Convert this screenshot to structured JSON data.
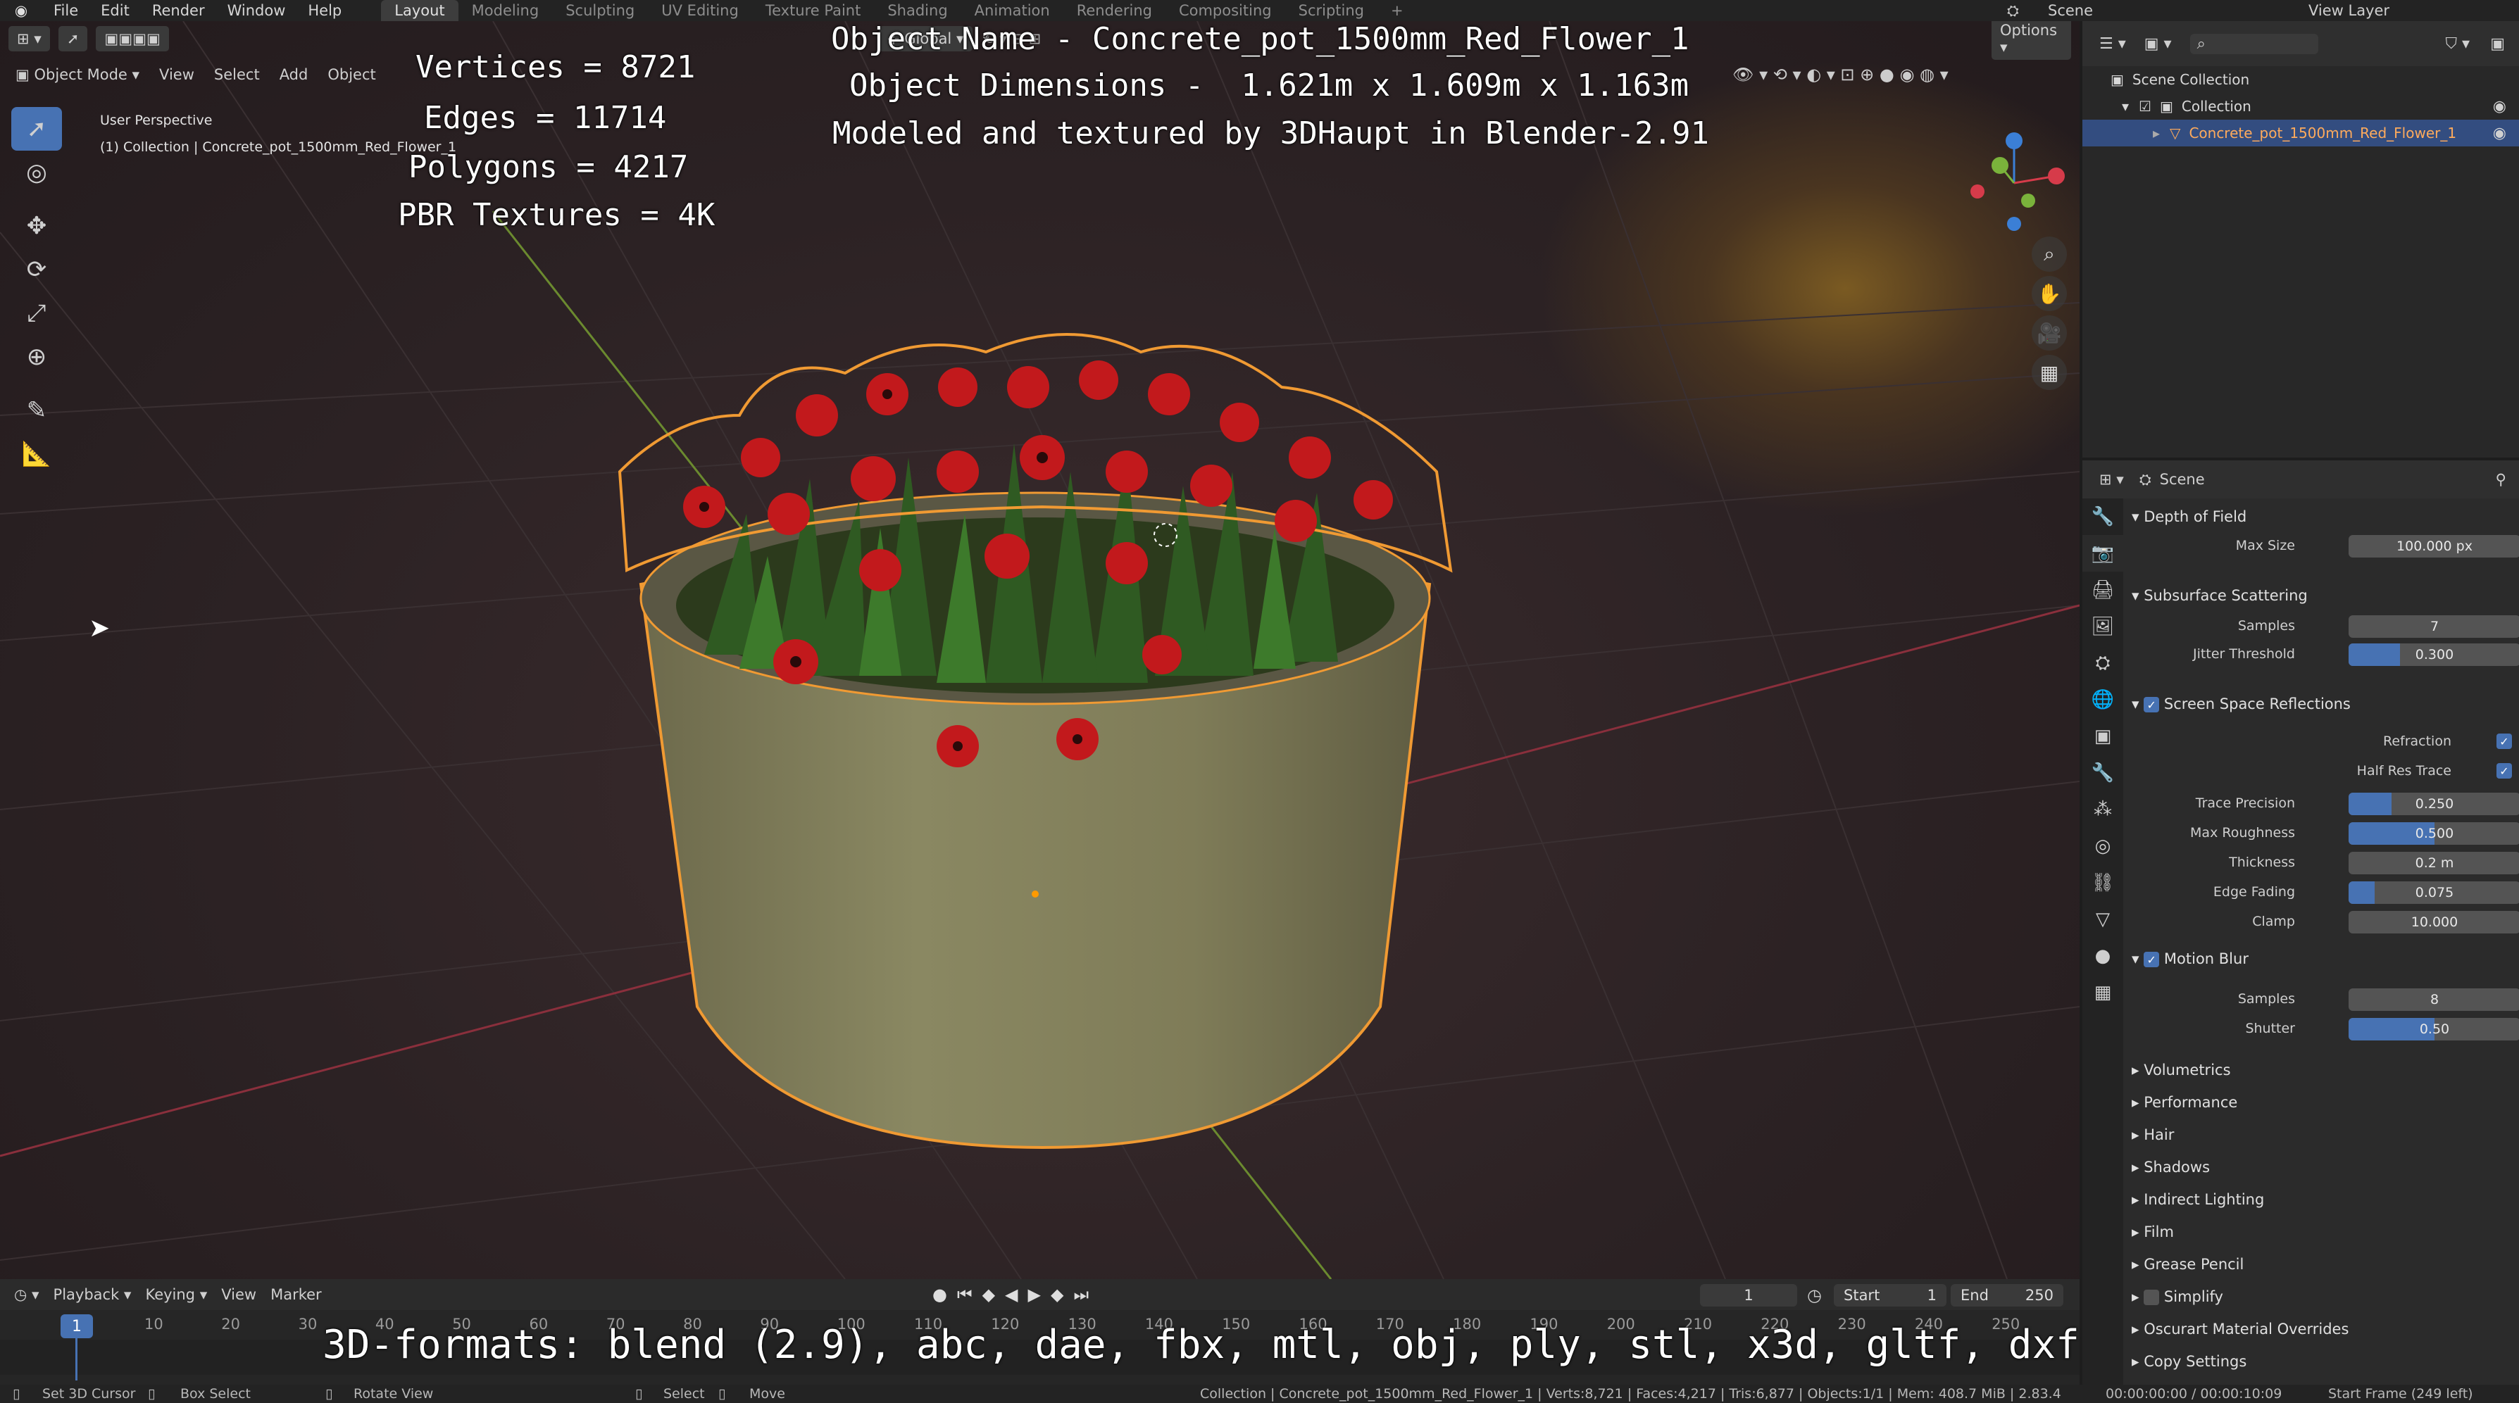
{
  "menu": [
    "File",
    "Edit",
    "Render",
    "Window",
    "Help"
  ],
  "workspaces": [
    "Layout",
    "Modeling",
    "Sculpting",
    "UV Editing",
    "Texture Paint",
    "Shading",
    "Animation",
    "Rendering",
    "Compositing",
    "Scripting"
  ],
  "active_workspace": "Layout",
  "top_right": {
    "scene": "Scene",
    "view_layer": "View Layer"
  },
  "viewport": {
    "mode": "Object Mode",
    "menus": [
      "View",
      "Select",
      "Add",
      "Object"
    ],
    "transform": "Global",
    "options": "Options",
    "perspective": "User Perspective",
    "collection": "(1) Collection | Concrete_pot_1500mm_Red_Flower_1"
  },
  "overlay": {
    "vertices": "Vertices = 8721",
    "edges": "Edges = 11714",
    "polygons": "Polygons = 4217",
    "textures": "PBR Textures = 4K",
    "object_name": "Object Name - Concrete_pot_1500mm_Red_Flower_1",
    "dimensions": "Object Dimensions -  1.621m x 1.609m x 1.163m",
    "credits": "Modeled and textured by 3DHaupt in Blender-2.91",
    "formats": "3D-formats: blend (2.9), abc, dae, fbx, mtl, obj, ply, stl, x3d, gltf, dxf"
  },
  "timeline": {
    "menus": [
      "Playback",
      "Keying",
      "View",
      "Marker"
    ],
    "current_frame": "1",
    "start_label": "Start",
    "start": "1",
    "end_label": "End",
    "end": "250",
    "ticks": [
      "10",
      "20",
      "30",
      "40",
      "50",
      "60",
      "70",
      "80",
      "90",
      "100",
      "110",
      "120",
      "130",
      "140",
      "150",
      "160",
      "170",
      "180",
      "190",
      "200",
      "210",
      "220",
      "230",
      "240",
      "250"
    ],
    "marker": "1"
  },
  "statusbar": {
    "set_cursor": "Set 3D Cursor",
    "box_select": "Box Select",
    "rotate": "Rotate View",
    "select": "Select",
    "move": "Move",
    "stats": "Collection | Concrete_pot_1500mm_Red_Flower_1 | Verts:8,721 | Faces:4,217 | Tris:6,877 | Objects:1/1 | Mem: 408.7 MiB | 2.83.4",
    "time": "00:00:00:00 / 00:00:10:09",
    "start_frame": "Start Frame (249 left)"
  },
  "outliner": {
    "scene_collection": "Scene Collection",
    "collection": "Collection",
    "object": "Concrete_pot_1500mm_Red_Flower_1"
  },
  "properties": {
    "context": "Scene",
    "dof": {
      "title": "Depth of Field",
      "max_size_label": "Max Size",
      "max_size": "100.000 px"
    },
    "sss": {
      "title": "Subsurface Scattering",
      "samples_label": "Samples",
      "samples": "7",
      "jitter_label": "Jitter Threshold",
      "jitter": "0.300",
      "jitter_frac": 0.3
    },
    "ssr": {
      "title": "Screen Space Reflections",
      "refraction": "Refraction",
      "half_res": "Half Res Trace",
      "trace_label": "Trace Precision",
      "trace": "0.250",
      "trace_frac": 0.25,
      "rough_label": "Max Roughness",
      "rough": "0.500",
      "rough_frac": 0.5,
      "thick_label": "Thickness",
      "thick": "0.2 m",
      "fade_label": "Edge Fading",
      "fade": "0.075",
      "fade_frac": 0.15,
      "clamp_label": "Clamp",
      "clamp": "10.000"
    },
    "mblur": {
      "title": "Motion Blur",
      "samples_label": "Samples",
      "samples": "8",
      "shutter_label": "Shutter",
      "shutter": "0.50",
      "shutter_frac": 0.5
    },
    "collapsed": [
      "Volumetrics",
      "Performance",
      "Hair",
      "Shadows",
      "Indirect Lighting",
      "Film",
      "Grease Pencil",
      "Simplify",
      "Oscurart Material Overrides",
      "Copy Settings"
    ]
  },
  "colors": {
    "accent": "#4772b3",
    "selection": "#ffa33c"
  }
}
